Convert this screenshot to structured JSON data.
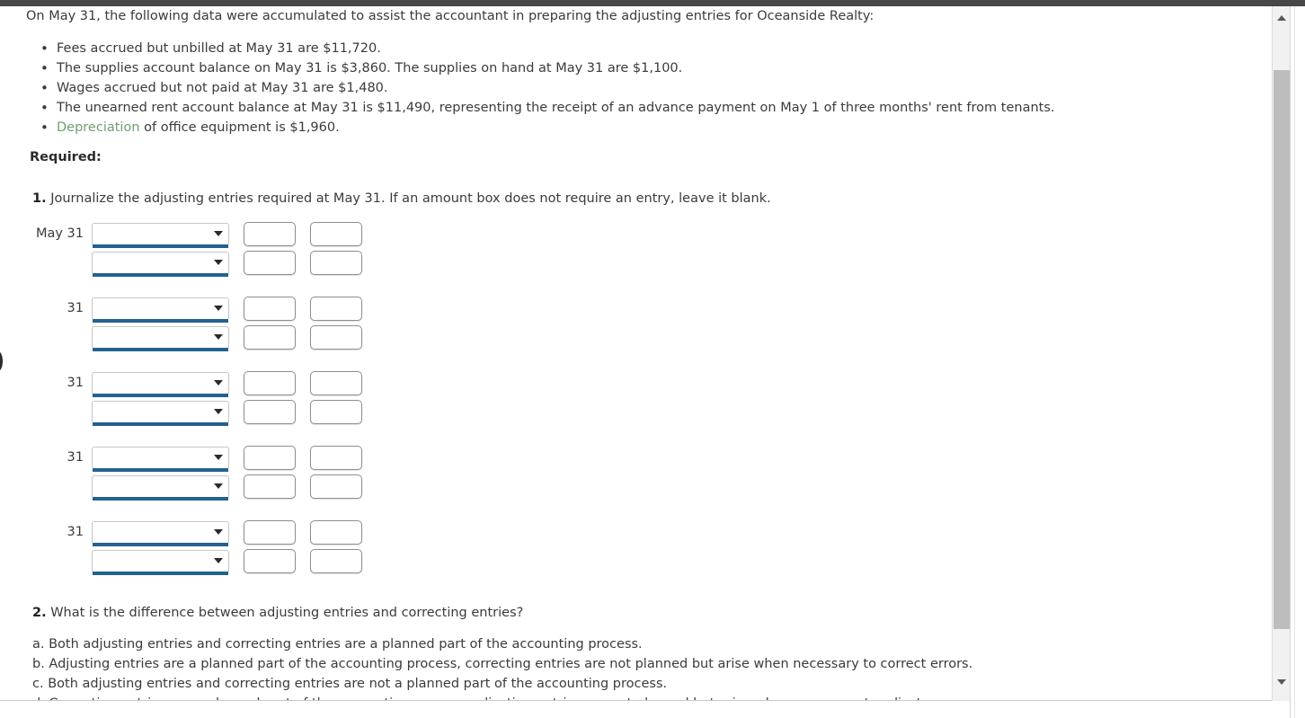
{
  "window": {
    "chrome_bar_color": "#474747",
    "page_background": "#ffffff"
  },
  "intro": {
    "text": "On May 31, the following data were accumulated to assist the accountant in preparing the adjusting entries for Oceanside Realty:"
  },
  "facts": [
    {
      "text": "Fees accrued but unbilled at May 31 are $11,720."
    },
    {
      "text": "The supplies account balance on May 31 is $3,860. The supplies on hand at May 31 are $1,100."
    },
    {
      "text": "Wages accrued but not paid at May 31 are $1,480."
    },
    {
      "text": "The unearned rent account balance at May 31 is $11,490, representing the receipt of an advance payment on May 1 of three months' rent from tenants."
    },
    {
      "term": "Depreciation",
      "text": " of office equipment is $1,960."
    }
  ],
  "required_heading": "Required:",
  "question1": {
    "number": "1.",
    "text": " Journalize the adjusting entries required at May 31. If an amount box does not require an entry, leave it blank.",
    "journal": {
      "select_placeholder": "",
      "debit_value": "",
      "credit_value": "",
      "groups": [
        {
          "date": "May 31",
          "rows": [
            {
              "account": "",
              "debit": "",
              "credit": ""
            },
            {
              "account": "",
              "debit": "",
              "credit": ""
            }
          ]
        },
        {
          "date": "31",
          "rows": [
            {
              "account": "",
              "debit": "",
              "credit": ""
            },
            {
              "account": "",
              "debit": "",
              "credit": ""
            }
          ]
        },
        {
          "date": "31",
          "rows": [
            {
              "account": "",
              "debit": "",
              "credit": ""
            },
            {
              "account": "",
              "debit": "",
              "credit": ""
            }
          ]
        },
        {
          "date": "31",
          "rows": [
            {
              "account": "",
              "debit": "",
              "credit": ""
            },
            {
              "account": "",
              "debit": "",
              "credit": ""
            }
          ]
        },
        {
          "date": "31",
          "rows": [
            {
              "account": "",
              "debit": "",
              "credit": ""
            },
            {
              "account": "",
              "debit": "",
              "credit": ""
            }
          ]
        }
      ]
    }
  },
  "question2": {
    "number": "2.",
    "text": " What is the difference between adjusting entries and correcting entries?",
    "choices": [
      "a. Both adjusting entries and correcting entries are a planned part of the accounting process.",
      "b. Adjusting entries are a planned part of the accounting process, correcting entries are not planned but arise when necessary to correct errors.",
      "c. Both adjusting entries and correcting entries are not a planned part of the accounting process.",
      "d. Correcting entries are a planned part of the accounting process, adjusting entries are not planned but arise when necessary to adjust errors."
    ]
  },
  "scrollbar": {
    "up_arrow_icon": "chevron-up-icon",
    "down_arrow_icon": "chevron-down-icon",
    "thumb_color": "#bdbdbd",
    "track_color": "#f1f1f1"
  },
  "theme": {
    "select_underline": "#22628f",
    "glossary_link": "#6f9e70",
    "body_text": "#3b3b3b"
  }
}
